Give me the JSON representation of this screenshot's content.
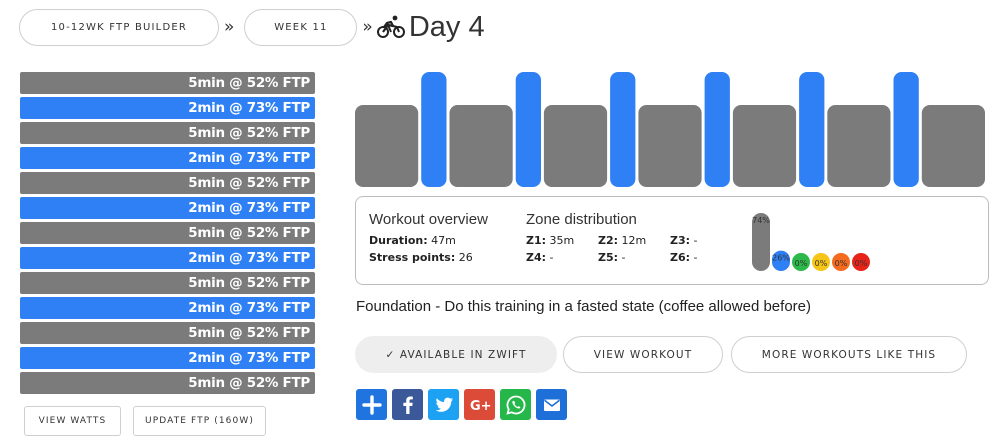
{
  "breadcrumb": {
    "program": "10-12WK FTP BUILDER",
    "week": "WEEK 11",
    "separator": "»",
    "day": "Day 4",
    "icon": "cyclist-icon"
  },
  "intervals": [
    {
      "label": "5min @ 52% FTP",
      "minutes": 5,
      "ftp_pct": 52,
      "zone": "gray"
    },
    {
      "label": "2min @ 73% FTP",
      "minutes": 2,
      "ftp_pct": 73,
      "zone": "blue"
    },
    {
      "label": "5min @ 52% FTP",
      "minutes": 5,
      "ftp_pct": 52,
      "zone": "gray"
    },
    {
      "label": "2min @ 73% FTP",
      "minutes": 2,
      "ftp_pct": 73,
      "zone": "blue"
    },
    {
      "label": "5min @ 52% FTP",
      "minutes": 5,
      "ftp_pct": 52,
      "zone": "gray"
    },
    {
      "label": "2min @ 73% FTP",
      "minutes": 2,
      "ftp_pct": 73,
      "zone": "blue"
    },
    {
      "label": "5min @ 52% FTP",
      "minutes": 5,
      "ftp_pct": 52,
      "zone": "gray"
    },
    {
      "label": "2min @ 73% FTP",
      "minutes": 2,
      "ftp_pct": 73,
      "zone": "blue"
    },
    {
      "label": "5min @ 52% FTP",
      "minutes": 5,
      "ftp_pct": 52,
      "zone": "gray"
    },
    {
      "label": "2min @ 73% FTP",
      "minutes": 2,
      "ftp_pct": 73,
      "zone": "blue"
    },
    {
      "label": "5min @ 52% FTP",
      "minutes": 5,
      "ftp_pct": 52,
      "zone": "gray"
    },
    {
      "label": "2min @ 73% FTP",
      "minutes": 2,
      "ftp_pct": 73,
      "zone": "blue"
    },
    {
      "label": "5min @ 52% FTP",
      "minutes": 5,
      "ftp_pct": 52,
      "zone": "gray"
    }
  ],
  "left_actions": {
    "view_watts": "VIEW WATTS",
    "update_ftp": "UPDATE FTP (160W)"
  },
  "overview": {
    "heading": "Workout overview",
    "duration_label": "Duration:",
    "duration_value": "47m",
    "stress_label": "Stress points:",
    "stress_value": "26"
  },
  "zones": {
    "heading": "Zone distribution",
    "items": [
      {
        "label": "Z1:",
        "value": "35m"
      },
      {
        "label": "Z2:",
        "value": "12m"
      },
      {
        "label": "Z3:",
        "value": "-"
      },
      {
        "label": "Z4:",
        "value": "-"
      },
      {
        "label": "Z5:",
        "value": "-"
      },
      {
        "label": "Z6:",
        "value": "-"
      }
    ]
  },
  "zone_chart": {
    "bars": [
      {
        "pct": 74,
        "label": "74%",
        "color": "#7b7b7b"
      },
      {
        "pct": 26,
        "label": "26%",
        "color": "#2f80f5"
      },
      {
        "pct": 0,
        "label": "0%",
        "color": "#2db84a"
      },
      {
        "pct": 0,
        "label": "0%",
        "color": "#f5c518"
      },
      {
        "pct": 0,
        "label": "0%",
        "color": "#f46a1f"
      },
      {
        "pct": 0,
        "label": "0%",
        "color": "#e8231a"
      }
    ]
  },
  "description": "Foundation - Do this training in a fasted state (coffee allowed before)",
  "actions": {
    "zwift": "✓ AVAILABLE IN ZWIFT",
    "view_workout": "VIEW WORKOUT",
    "more_like": "MORE WORKOUTS LIKE THIS"
  },
  "share": [
    {
      "name": "addthis-icon",
      "color": "#1f74e0"
    },
    {
      "name": "facebook-icon",
      "color": "#3b5998"
    },
    {
      "name": "twitter-icon",
      "color": "#1da1f2"
    },
    {
      "name": "google-plus-icon",
      "color": "#dc4a38"
    },
    {
      "name": "whatsapp-icon",
      "color": "#25b74a"
    },
    {
      "name": "email-icon",
      "color": "#1f6fd8"
    }
  ],
  "colors": {
    "z1": "#7b7b7b",
    "z2": "#2f80f5"
  }
}
